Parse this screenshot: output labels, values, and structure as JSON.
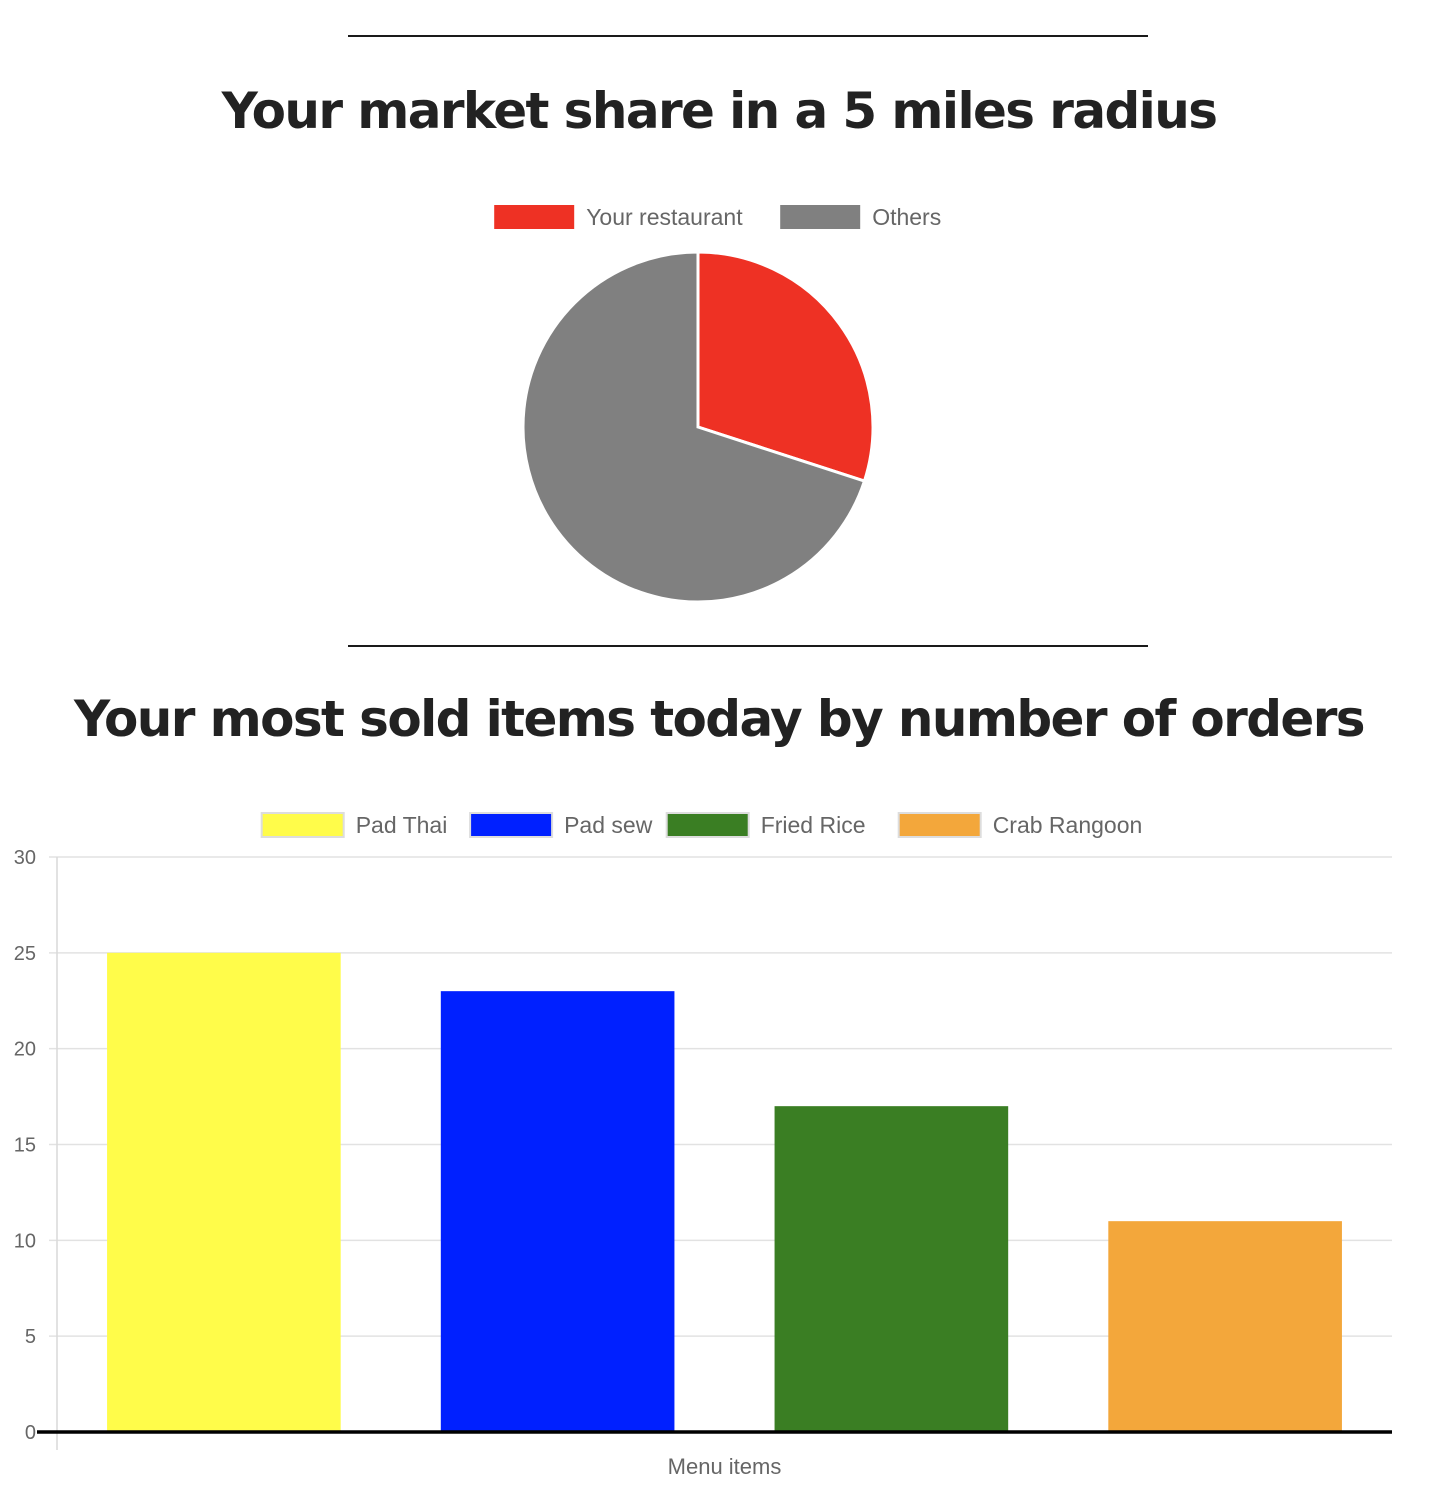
{
  "charts": {
    "pie": {
      "title": "Your market share in a 5 miles radius",
      "chart_data": {
        "type": "pie",
        "title": "Your market share in a 5 miles radius",
        "legend_position": "top",
        "labels": [
          "Your restaurant",
          "Others"
        ],
        "values": [
          30,
          70
        ],
        "colors": [
          "#ee3124",
          "#808080"
        ]
      }
    },
    "bar": {
      "title": "Your most sold items today by number of orders",
      "chart_data": {
        "type": "bar",
        "title": "Your most sold items today by number of orders",
        "xlabel": "Menu items",
        "ylabel": "",
        "ylim": [
          0,
          30
        ],
        "yticks": [
          0,
          5,
          10,
          15,
          20,
          25,
          30
        ],
        "grid": true,
        "legend_position": "top",
        "series": [
          {
            "name": "Pad Thai",
            "values": [
              25
            ],
            "color": "#fffc4a"
          },
          {
            "name": "Pad sew",
            "values": [
              23
            ],
            "color": "#0020ff"
          },
          {
            "name": "Fried Rice",
            "values": [
              17
            ],
            "color": "#3a7e23"
          },
          {
            "name": "Crab Rangoon",
            "values": [
              11
            ],
            "color": "#f3a73b"
          }
        ]
      }
    }
  }
}
